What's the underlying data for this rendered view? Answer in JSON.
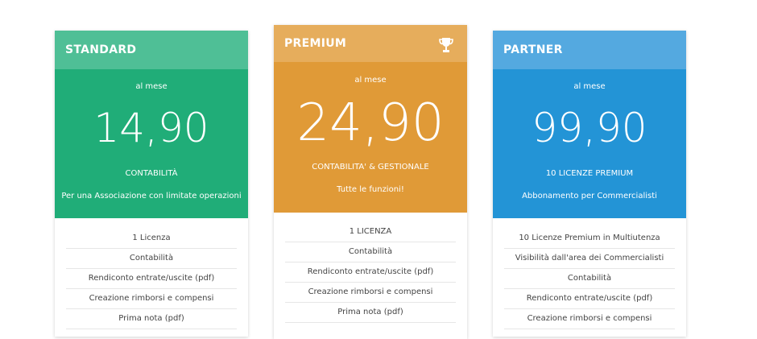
{
  "colors": {
    "standard_head": "#4fbf96",
    "standard_body": "#20ad78",
    "premium_head": "#e6ad5c",
    "premium_body": "#e09a37",
    "partner_head": "#54a9e0",
    "partner_body": "#2394d6"
  },
  "plans": [
    {
      "name": "STANDARD",
      "per": "al mese",
      "price": "14,90",
      "category": "CONTABILITÀ",
      "description": "Per una Associazione con limitate operazioni",
      "features": [
        "1 Licenza",
        "Contabilità",
        "Rendiconto entrate/uscite (pdf)",
        "Creazione rimborsi e compensi",
        "Prima nota (pdf)"
      ]
    },
    {
      "name": "PREMIUM",
      "icon": "trophy-icon",
      "per": "al mese",
      "price": "24,90",
      "category": "CONTABILITA' & GESTIONALE",
      "description": "Tutte le funzioni!",
      "features": [
        "1 LICENZA",
        "Contabilità",
        "Rendiconto entrate/uscite (pdf)",
        "Creazione rimborsi e compensi",
        "Prima nota (pdf)"
      ]
    },
    {
      "name": "PARTNER",
      "per": "al mese",
      "price": "99,90",
      "category": "10 LICENZE PREMIUM",
      "description": "Abbonamento per Commercialisti",
      "features": [
        "10 Licenze Premium in Multiutenza",
        "Visibilità dall'area dei Commercialisti",
        "Contabilità",
        "Rendiconto entrate/uscite (pdf)",
        "Creazione rimborsi e compensi"
      ]
    }
  ]
}
